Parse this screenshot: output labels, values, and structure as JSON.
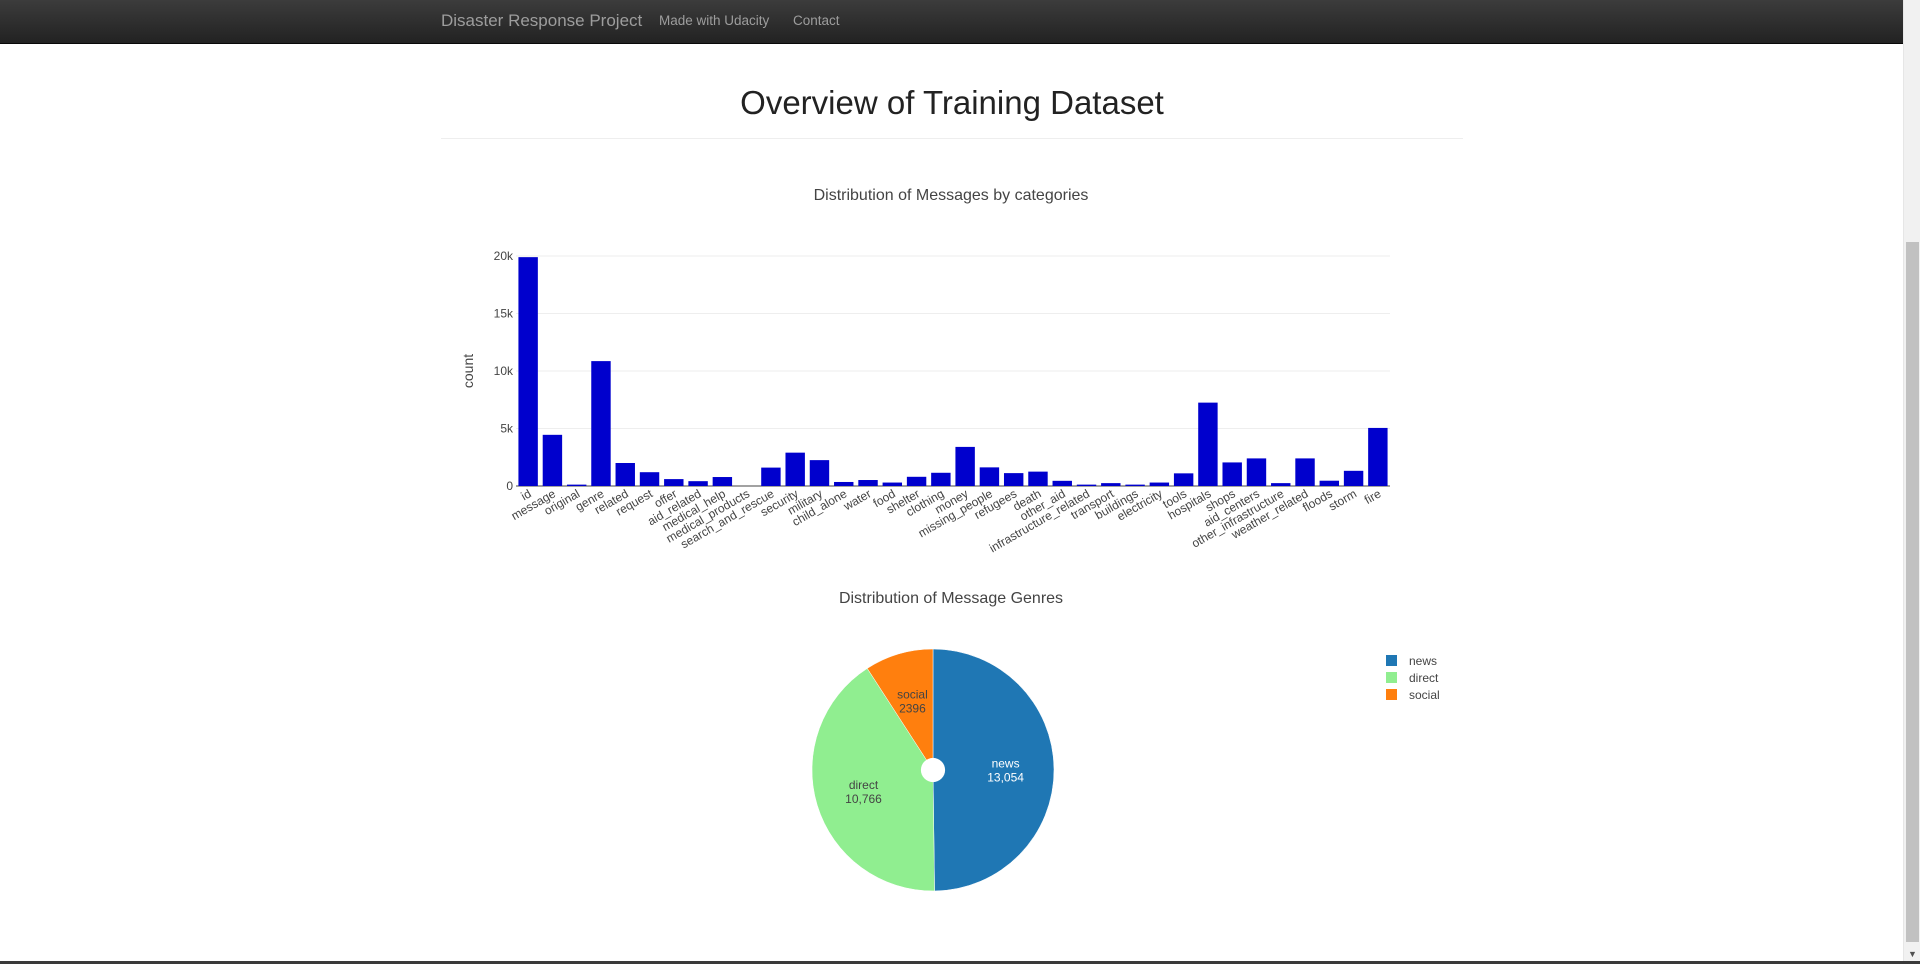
{
  "navbar": {
    "brand": "Disaster Response Project",
    "links": [
      "Made with Udacity",
      "Contact"
    ]
  },
  "page": {
    "title": "Overview of Training Dataset"
  },
  "colors": {
    "bar": "#0000cd",
    "news": "#1f77b4",
    "direct": "#90ee90",
    "social": "#ff7f0e"
  },
  "chart_data": [
    {
      "type": "bar",
      "title": "Distribution of Messages by categories",
      "xlabel": "",
      "ylabel": "count",
      "ylim": [
        0,
        20000
      ],
      "yticks": [
        0,
        5000,
        10000,
        15000,
        20000
      ],
      "ytick_labels": [
        "0",
        "5k",
        "10k",
        "15k",
        "20k"
      ],
      "grid": true,
      "categories": [
        "id",
        "message",
        "original",
        "genre",
        "related",
        "request",
        "offer",
        "aid_related",
        "medical_help",
        "medical_products",
        "search_and_rescue",
        "security",
        "military",
        "child_alone",
        "water",
        "food",
        "shelter",
        "clothing",
        "money",
        "missing_people",
        "refugees",
        "death",
        "other_aid",
        "infrastructure_related",
        "transport",
        "buildings",
        "electricity",
        "tools",
        "hospitals",
        "shops",
        "aid_centers",
        "other_infrastructure",
        "weather_related",
        "floods",
        "storm",
        "fire"
      ],
      "values": [
        19900,
        4450,
        120,
        10860,
        2000,
        1200,
        600,
        420,
        780,
        0,
        1600,
        2900,
        2250,
        350,
        520,
        300,
        800,
        1150,
        3400,
        1620,
        1120,
        1250,
        450,
        120,
        250,
        120,
        300,
        1100,
        7250,
        2050,
        2400,
        250,
        2400,
        460,
        1320,
        5050
      ]
    },
    {
      "type": "pie",
      "title": "Distribution of Message Genres",
      "hole": 0.1,
      "legend_position": "top-right",
      "labels": [
        "news",
        "direct",
        "social"
      ],
      "values": [
        13054,
        10766,
        2396
      ],
      "value_labels": [
        "13,054",
        "10,766",
        "2396"
      ]
    }
  ]
}
